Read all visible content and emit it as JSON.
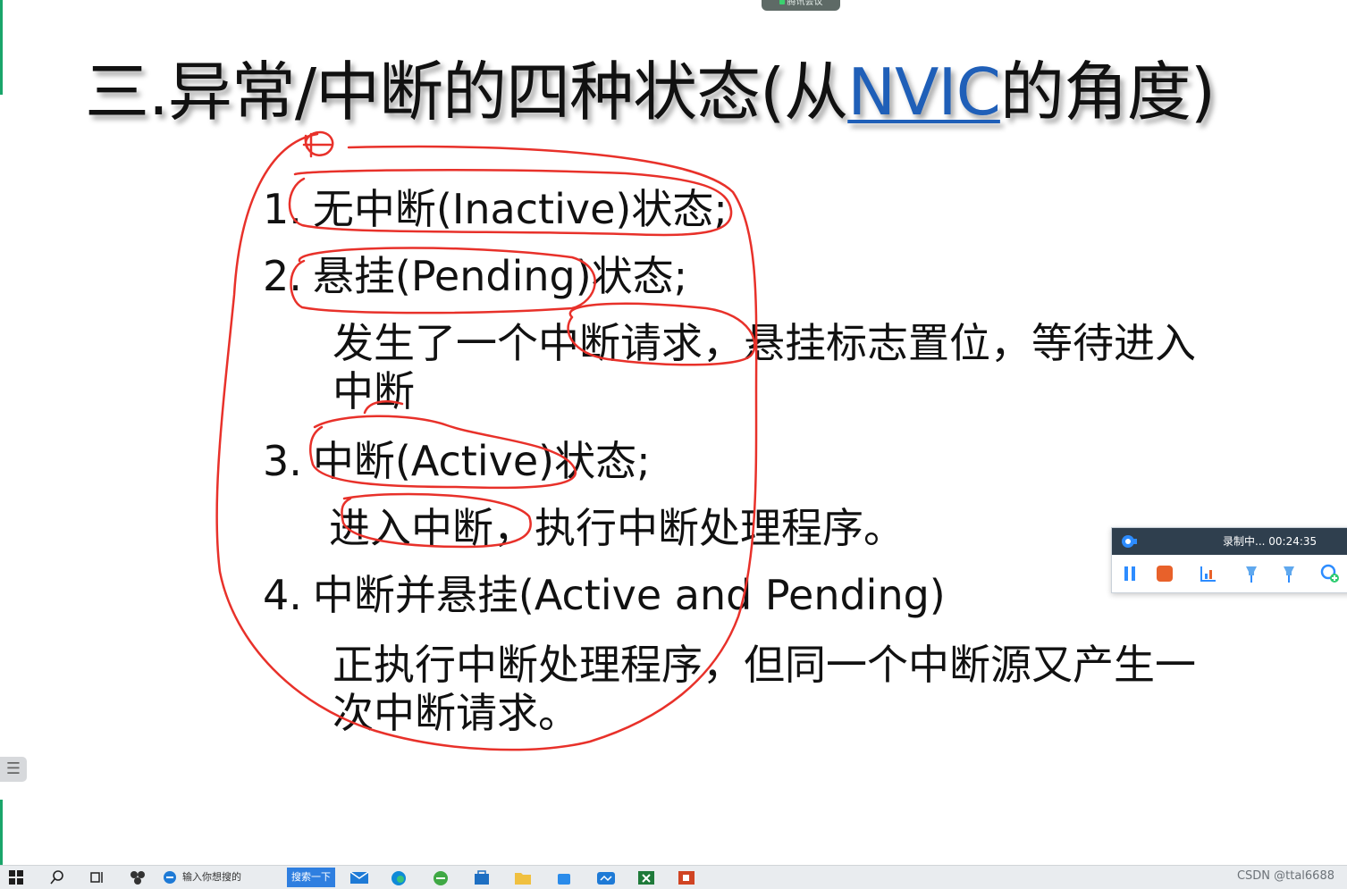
{
  "meeting_tab": {
    "label": "腾讯会议"
  },
  "slide": {
    "title_prefix": "三.异常/中断的四种状态(从",
    "title_link": "NVIC",
    "title_suffix": "的角度)",
    "items": [
      {
        "num": "1.",
        "text": "无中断(Inactive)状态;"
      },
      {
        "num": "2.",
        "text": "悬挂(Pending)状态;"
      },
      {
        "num": "3.",
        "text": "中断(Active)状态;"
      },
      {
        "num": "4.",
        "text": "中断并悬挂(Active and Pending)"
      }
    ],
    "desc_2_line1": "发生了一个中断请求，悬挂标志置位，等待进入",
    "desc_2_line2": "中断",
    "desc_3": "进入中断，执行中断处理程序。",
    "desc_4_line1": "正执行中断处理程序，但同一个中断源又产生一",
    "desc_4_line2": "次中断请求。"
  },
  "recorder": {
    "status": "录制中... 00:24:35",
    "icons": [
      "camera-icon",
      "pause-icon",
      "stop-icon",
      "chart-icon",
      "pin-icon",
      "pin-icon",
      "zoom-add-icon"
    ]
  },
  "taskbar": {
    "search_placeholder": "输入你想搜的",
    "search_button": "搜索一下",
    "watermark": "CSDN @ttal6688"
  },
  "colors": {
    "ink": "#e8312a",
    "link": "#1f5fb8",
    "accent": "#1aa56a",
    "recorder_bar": "#2f3f4e"
  }
}
